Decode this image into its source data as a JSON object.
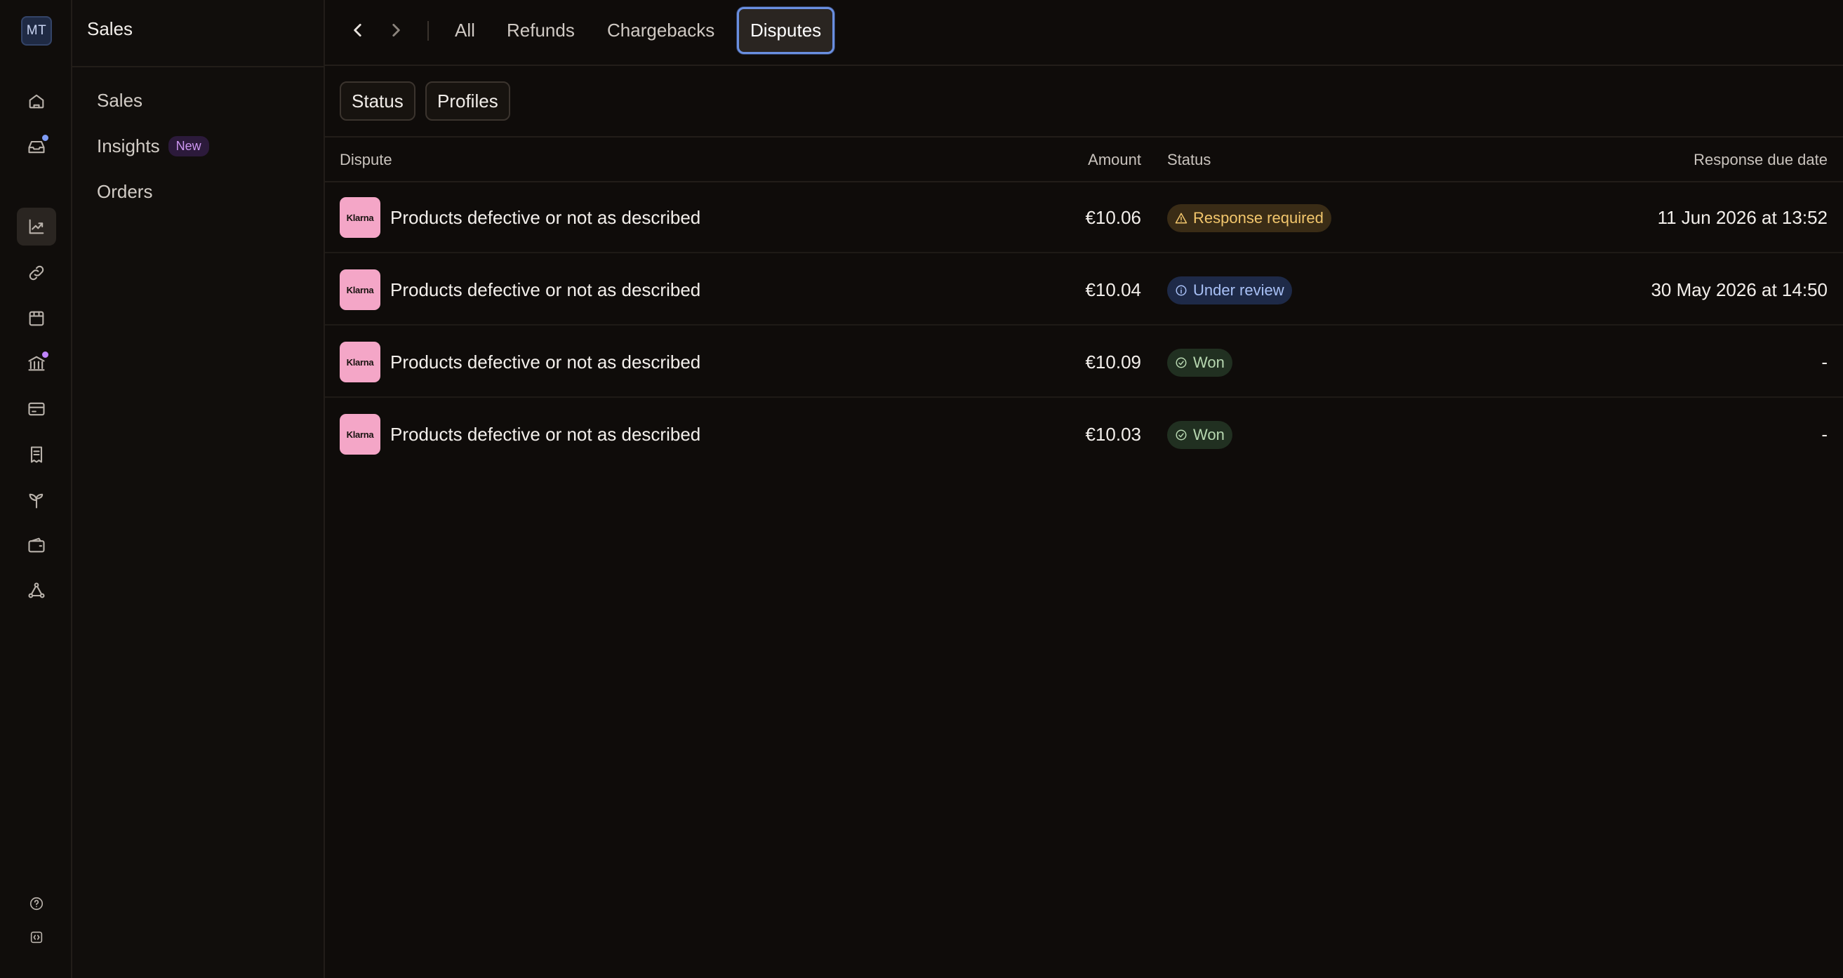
{
  "rail": {
    "avatar_initials": "MT",
    "icons": [
      "home-icon",
      "inbox-icon",
      "chart-icon",
      "link-icon",
      "store-icon",
      "bank-icon",
      "card-icon",
      "receipt-icon",
      "sprout-icon",
      "wallet-icon",
      "network-icon",
      "help-icon",
      "code-icon"
    ],
    "inbox_dot_color": "#7f9cf5",
    "bank_dot_color": "#c084fc"
  },
  "subnav": {
    "title": "Sales",
    "items": [
      {
        "label": "Sales"
      },
      {
        "label": "Insights",
        "badge": "New"
      },
      {
        "label": "Orders"
      }
    ]
  },
  "tabs": [
    {
      "label": "All"
    },
    {
      "label": "Refunds"
    },
    {
      "label": "Chargebacks"
    },
    {
      "label": "Disputes",
      "active": true
    }
  ],
  "filters": {
    "status": "Status",
    "profiles": "Profiles"
  },
  "table": {
    "columns": [
      "Dispute",
      "Amount",
      "Status",
      "Response due date"
    ],
    "rows": [
      {
        "logo": "Klarna",
        "dispute": "Products defective or not as described",
        "amount": "€10.06",
        "status": "Response required",
        "due": "11 Jun 2026 at 13:52"
      },
      {
        "logo": "Klarna",
        "dispute": "Products defective or not as described",
        "amount": "€10.04",
        "status": "Under review",
        "due": "30 May 2026 at 14:50"
      },
      {
        "logo": "Klarna",
        "dispute": "Products defective or not as described",
        "amount": "€10.09",
        "status": "Won",
        "due": "-"
      },
      {
        "logo": "Klarna",
        "dispute": "Products defective or not as described",
        "amount": "€10.03",
        "status": "Won",
        "due": "-"
      }
    ]
  },
  "colors": {
    "accent": "#6a8fe0",
    "warning": "#f2c66c",
    "review": "#a8c0f5",
    "won": "#b7d7b0",
    "klarna_pink": "#f4a6c7"
  }
}
